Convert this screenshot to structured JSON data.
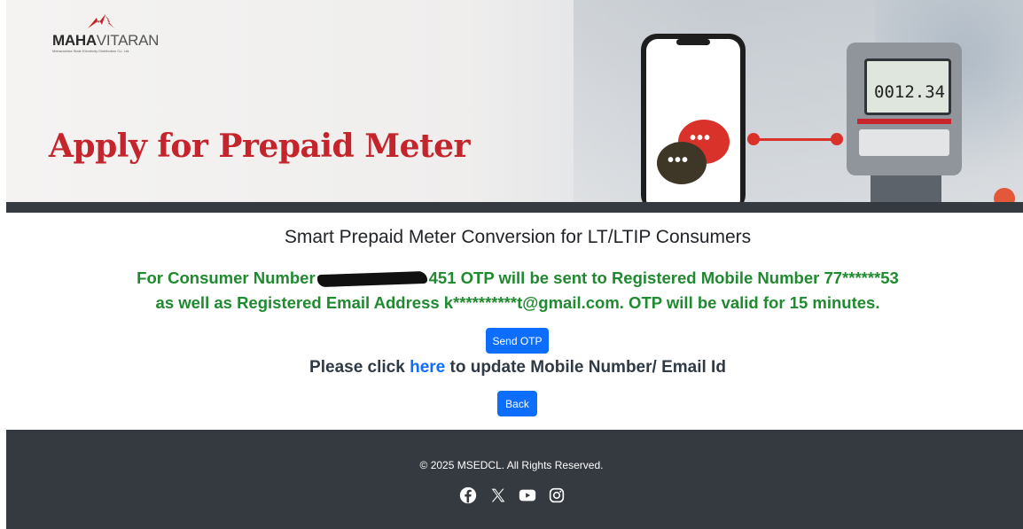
{
  "banner": {
    "logo_bold": "MAHA",
    "logo_light": "VITARAN",
    "logo_tagline": "Maharashtra State Electricity Distribution Co. Ltd.",
    "title": "Apply for Prepaid Meter",
    "meter_reading": "0012.34",
    "colors": {
      "title": "#c4242b",
      "accent": "#d8322b"
    }
  },
  "main": {
    "heading": "Smart Prepaid Meter Conversion for LT/LTIP Consumers",
    "info_prefix": "For Consumer Number",
    "info_consumer_suffix": "451",
    "info_middle": " OTP will be sent to Registered Mobile Number 77******53",
    "info_line2": "as well as Registered Email Address k**********t@gmail.com. OTP will be valid for 15 minutes.",
    "send_otp_label": "Send OTP",
    "update_prefix": "Please click ",
    "update_link": "here",
    "update_suffix": " to update Mobile Number/ Email Id",
    "back_label": "Back",
    "colors": {
      "info_text": "#1f8a2f",
      "button": "#0d6efd",
      "link": "#0d6efd"
    }
  },
  "footer": {
    "copyright": "© 2025 MSEDCL. All Rights Reserved.",
    "social_icons": [
      "facebook-icon",
      "x-icon",
      "youtube-icon",
      "instagram-icon"
    ]
  }
}
